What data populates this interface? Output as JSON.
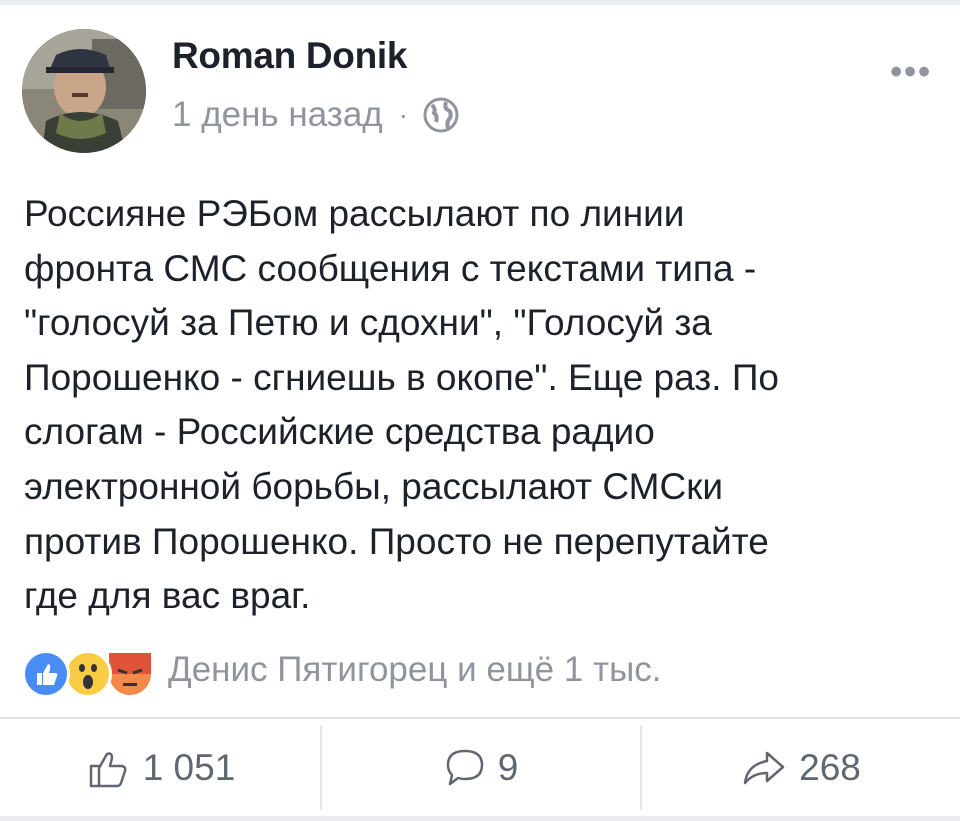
{
  "post": {
    "author": "Roman Donik",
    "time": "1 день назад",
    "separator": "·",
    "privacy_icon": "globe-icon",
    "more_label": "•••",
    "text": "Россияне РЭБом рассылают по линии\nфронта СМС сообщения с текстами типа -\n\"голосуй за Петю и сдохни\", \"Голосуй за\nПорошенко - сгниешь в окопе\". Еще раз. По\nслогам - Российские средства радио\nэлектронной борьбы, рассылают СМСки\nпротив Порошенко. Просто не перепутайте\nгде для вас враг."
  },
  "reactions": {
    "icons": [
      "like-reaction-icon",
      "wow-reaction-icon",
      "angry-reaction-icon"
    ],
    "summary": "Денис Пятигорец и ещё 1 тыс."
  },
  "actions": {
    "likes": "1 051",
    "comments": "9",
    "shares": "268"
  },
  "colors": {
    "like_blue": "#4a8cf6",
    "wow_yellow": "#f9cc45",
    "angry_orange": "#f28b4a",
    "secondary_text": "#90949c"
  }
}
